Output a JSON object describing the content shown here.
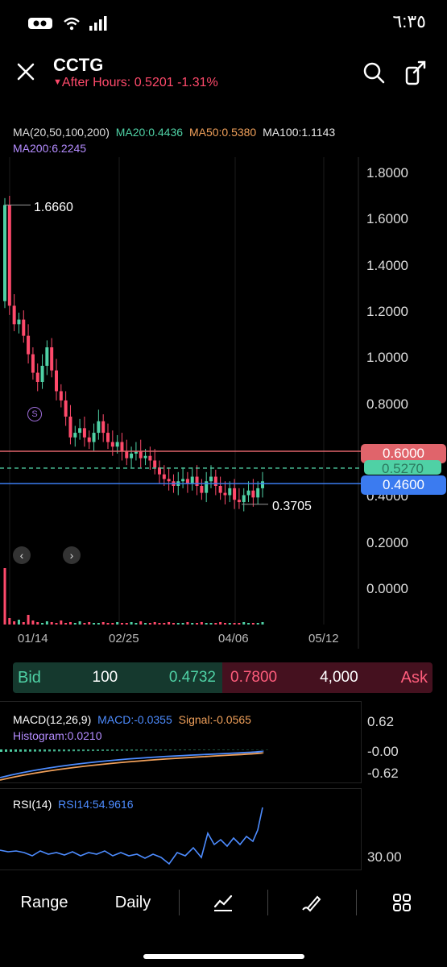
{
  "status_bar": {
    "time": "٦:٣٥"
  },
  "header": {
    "symbol": "CCTG",
    "after_hours": "After Hours: 0.5201 -1.31%",
    "close_icon": "close-icon",
    "search_icon": "search-icon",
    "share_icon": "share-icon"
  },
  "ma": {
    "label": "MA(20,50,100,200)",
    "ma20": "MA20:0.4436",
    "ma50": "MA50:0.5380",
    "ma100": "MA100:1.1143",
    "ma200": "MA200:6.2245",
    "colors": {
      "ma20": "#4fd1a5",
      "ma50": "#f0a05a",
      "ma100": "#e8e8e8",
      "ma200": "#b48cff"
    }
  },
  "chart_data": {
    "type": "candlestick",
    "y_ticks": [
      "1.8000",
      "1.6000",
      "1.4000",
      "1.2000",
      "1.0000",
      "0.8000",
      "0.6000",
      "0.4000",
      "0.2000",
      "0.0000"
    ],
    "x_ticks": [
      "01/14",
      "02/25",
      "04/06",
      "05/12"
    ],
    "ylim": [
      0.0,
      1.8
    ],
    "high_annotation": "1.6660",
    "low_annotation": "0.3705",
    "lines": [
      {
        "label": "0.6000",
        "value": 0.6,
        "color": "#e0646b"
      },
      {
        "label": "0.5270",
        "value": 0.527,
        "color": "#4fd1a5"
      },
      {
        "label": "0.4600",
        "value": 0.46,
        "color": "#3b7bf0"
      }
    ],
    "closes": [
      1.666,
      1.23,
      1.15,
      1.17,
      1.1,
      1.02,
      0.94,
      0.9,
      0.97,
      1.05,
      0.95,
      0.86,
      0.82,
      0.75,
      0.66,
      0.68,
      0.7,
      0.66,
      0.64,
      0.68,
      0.73,
      0.68,
      0.64,
      0.62,
      0.64,
      0.6,
      0.57,
      0.59,
      0.6,
      0.57,
      0.58,
      0.56,
      0.53,
      0.5,
      0.48,
      0.47,
      0.45,
      0.47,
      0.48,
      0.46,
      0.49,
      0.45,
      0.42,
      0.47,
      0.49,
      0.45,
      0.42,
      0.41,
      0.44,
      0.39,
      0.38,
      0.41,
      0.43,
      0.4,
      0.44,
      0.47
    ]
  },
  "annotations": {
    "s_marker": "S"
  },
  "bid_ask": {
    "bid_label": "Bid",
    "bid_size": "100",
    "bid_price": "0.4732",
    "ask_price": "0.7800",
    "ask_size": "4,000",
    "ask_label": "Ask"
  },
  "macd": {
    "label": "MACD(12,26,9)",
    "macd": "MACD:-0.0355",
    "signal": "Signal:-0.0565",
    "histogram": "Histogram:0.0210",
    "ticks": [
      "0.62",
      "-0.00",
      "-0.62"
    ]
  },
  "rsi": {
    "label": "RSI(14)",
    "value": "RSI14:54.9616",
    "tick": "30.00"
  },
  "toolbar": {
    "range": "Range",
    "daily": "Daily",
    "draw_icon": "line-chart-icon",
    "pen_icon": "pen-icon",
    "grid_icon": "grid-icon"
  }
}
